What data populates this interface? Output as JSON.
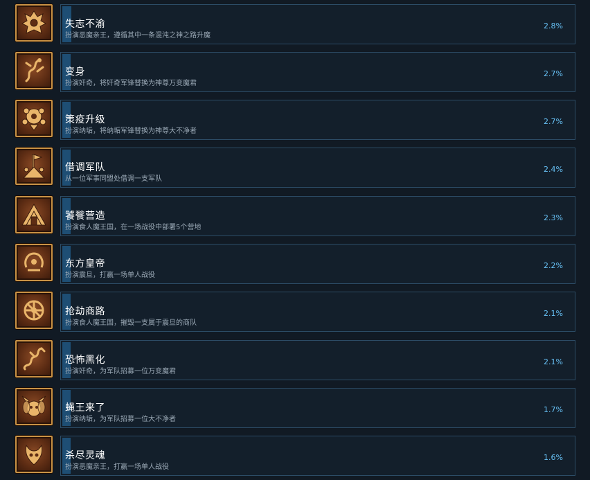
{
  "colors": {
    "page_background": "#111a24",
    "card_border": "#2c4c66",
    "progress_bar": "#1e4e74",
    "title_text": "#ffffff",
    "description_text": "#9aa8b5",
    "percent_text": "#67c1f5",
    "icon_frame": "#c89245"
  },
  "achievements": [
    {
      "title": "失志不渝",
      "description": "扮演恶魔亲王，遵循其中一条混沌之神之路升魔",
      "percent": "2.8%",
      "progress": 0.028,
      "icon": "demon-crest-icon"
    },
    {
      "title": "变身",
      "description": "扮演奸奇，将奸奇军锋替换为神尊万变魔君",
      "percent": "2.7%",
      "progress": 0.027,
      "icon": "serpent-figure-icon"
    },
    {
      "title": "策疫升级",
      "description": "扮演纳垢，将纳垢军锋替换为神尊大不净者",
      "percent": "2.7%",
      "progress": 0.027,
      "icon": "plague-emblem-icon"
    },
    {
      "title": "借调军队",
      "description": "从一位军事同盟处借调一支军队",
      "percent": "2.4%",
      "progress": 0.024,
      "icon": "army-banner-icon"
    },
    {
      "title": "饕餮营造",
      "description": "扮演食人魔王国，在一场战役中部署5个营地",
      "percent": "2.3%",
      "progress": 0.023,
      "icon": "ogre-camp-icon"
    },
    {
      "title": "东方皇帝",
      "description": "扮演震旦，打赢一场单人战役",
      "percent": "2.2%",
      "progress": 0.022,
      "icon": "eastern-wreath-icon"
    },
    {
      "title": "抢劫商路",
      "description": "扮演食人魔王国，摧毁一支属于震旦的商队",
      "percent": "2.1%",
      "progress": 0.021,
      "icon": "broken-wheel-icon"
    },
    {
      "title": "恐怖黑化",
      "description": "扮演奸奇，为军队招募一位万变魔君",
      "percent": "2.1%",
      "progress": 0.021,
      "icon": "dragon-icon"
    },
    {
      "title": "蝇王来了",
      "description": "扮演纳垢，为军队招募一位大不净者",
      "percent": "1.7%",
      "progress": 0.017,
      "icon": "fly-lord-icon"
    },
    {
      "title": "杀尽灵魂",
      "description": "扮演恶魔亲王，打赢一场单人战役",
      "percent": "1.6%",
      "progress": 0.016,
      "icon": "horned-skull-icon"
    }
  ]
}
